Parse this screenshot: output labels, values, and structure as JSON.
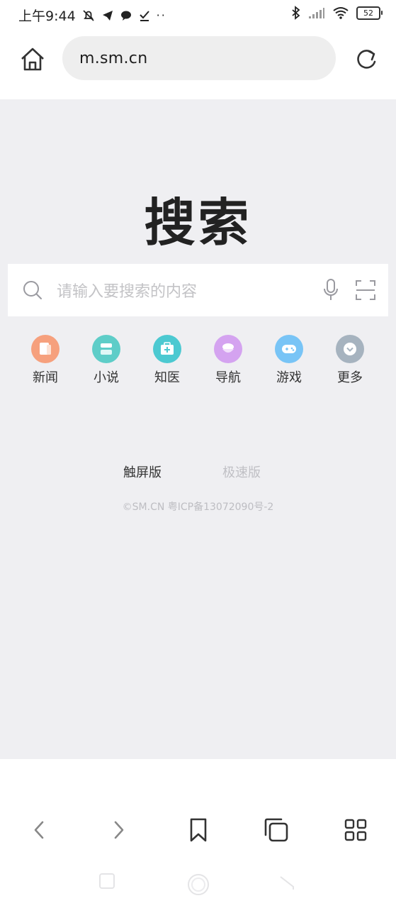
{
  "status_bar": {
    "time": "上午9:44",
    "battery": "52"
  },
  "address_bar": {
    "url": "m.sm.cn"
  },
  "page": {
    "logo": "搜索",
    "search": {
      "placeholder": "请输入要搜索的内容"
    },
    "quick_links": [
      {
        "label": "新闻",
        "color": "#f6a07d"
      },
      {
        "label": "小说",
        "color": "#5ecdc8"
      },
      {
        "label": "知医",
        "color": "#4cc9d1"
      },
      {
        "label": "导航",
        "color": "#d4a3f0"
      },
      {
        "label": "游戏",
        "color": "#78c4f6"
      },
      {
        "label": "更多",
        "color": "#a6b3bf"
      }
    ],
    "versions": {
      "touch": "触屏版",
      "fast": "极速版"
    },
    "icp": "©SM.CN 粤ICP备13072090号-2"
  },
  "colors": {
    "page_bg": "#efeff2",
    "accent_text": "#333333",
    "muted_text": "#bdbdc2"
  }
}
